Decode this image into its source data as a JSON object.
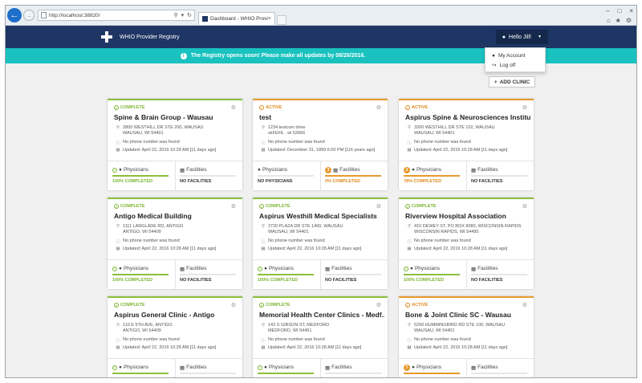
{
  "browser": {
    "url": "http://localhost:38820/",
    "tab_title": "Dashboard - WHIO Provide..."
  },
  "header": {
    "brand": "WHIO Provider Registry",
    "user_greeting": "Hello Jill!"
  },
  "banner": {
    "text": "The Registry opens soon! Please make all updates by 08/26/2016."
  },
  "user_menu": {
    "items": [
      "My Account",
      "Log off"
    ]
  },
  "toolbar": {
    "add_clinic": "ADD CLINIC"
  },
  "labels": {
    "physicians": "Physicians",
    "facilities": "Facilities"
  },
  "colors": {
    "navbar": "#1f3564",
    "banner": "#19c2bf",
    "complete": "#8cbf3f",
    "active": "#e69a2e"
  },
  "cards": [
    {
      "status": "COMPLETE",
      "name": "Spine & Brain Group - Wausau",
      "address1": "2800 WESTHILL DR STE 200, WAUSAU",
      "address2": "WAUSAU, WI 54401",
      "phone": "No phone number was found",
      "updated": "Updated: April 22, 2016 10:28 AM [11 days ago]",
      "phys_badge": "",
      "phys_pct": "100% COMPLETED",
      "fac_badge": "",
      "fac_pct": "NO FACILITIES"
    },
    {
      "status": "ACTIVE",
      "name": "test",
      "address1": "1234 testcom drive",
      "address2": "skFEFE , wi 53066",
      "phone": "No phone number was found",
      "updated": "Updated: December 31, 1899 6:00 PM [116 years ago]",
      "phys_badge": "",
      "phys_pct": "NO PHYSICIANS",
      "fac_badge": "3",
      "fac_pct": "0% COMPLETED"
    },
    {
      "status": "ACTIVE",
      "name": "Aspirus Spine & Neurosciences Institute",
      "address1": "3200 WESTHILL DR STE 102, WAUSAU",
      "address2": "WAUSAU, WI 54401",
      "phone": "No phone number was found",
      "updated": "Updated: April 22, 2016 10:28 AM [11 days ago]",
      "phys_badge": "2",
      "phys_pct": "78% COMPLETED",
      "fac_badge": "",
      "fac_pct": "NO FACILITIES"
    },
    {
      "status": "COMPLETE",
      "name": "Antigo Medical Building",
      "address1": "1111 LANGLADE RD, ANTIGO",
      "address2": "ANTIGO, WI 54409",
      "phone": "No phone number was found",
      "updated": "Updated: April 22, 2016 10:28 AM [11 days ago]",
      "phys_badge": "",
      "phys_pct": "100% COMPLETED",
      "fac_badge": "",
      "fac_pct": "NO FACILITIES"
    },
    {
      "status": "COMPLETE",
      "name": "Aspirus Westhill Medical Specialists",
      "address1": "2720 PLAZA DR STE 1400, WAUSAU",
      "address2": "WAUSAU, WI 54401",
      "phone": "No phone number was found",
      "updated": "Updated: April 22, 2016 10:28 AM [11 days ago]",
      "phys_badge": "",
      "phys_pct": "100% COMPLETED",
      "fac_badge": "",
      "fac_pct": "NO FACILITIES"
    },
    {
      "status": "COMPLETE",
      "name": "Riverview Hospital Association",
      "address1": "410 DEWEY ST, PO BOX 8080, WISCONSIN RAPIDS",
      "address2": "WISCONSIN RAPIDS, WI 54495",
      "phone": "No phone number was found",
      "updated": "Updated: April 22, 2016 10:28 AM [11 days ago]",
      "phys_badge": "",
      "phys_pct": "100% COMPLETED",
      "fac_badge": "",
      "fac_pct": "NO FACILITIES"
    },
    {
      "status": "COMPLETE",
      "name": "Aspirus General Clinic - Antigo",
      "address1": "110 E 5TH AVE, ANTIGO",
      "address2": "ANTIGO, WI 54409",
      "phone": "No phone number was found",
      "updated": "Updated: April 22, 2016 10:28 AM [11 days ago]",
      "phys_badge": "",
      "phys_pct": "",
      "fac_badge": "",
      "fac_pct": ""
    },
    {
      "status": "COMPLETE",
      "name": "Memorial Health Center Clinics - Medf...",
      "address1": "143 S GIBSON ST, MEDFORD",
      "address2": "MEDFORD, WI 54451",
      "phone": "No phone number was found",
      "updated": "Updated: April 22, 2016 10:28 AM [11 days ago]",
      "phys_badge": "",
      "phys_pct": "",
      "fac_badge": "",
      "fac_pct": ""
    },
    {
      "status": "ACTIVE",
      "name": "Bone & Joint Clinic SC - Wausau",
      "address1": "5200 HUMMINGBIRD RD STE 100, WAUSAU",
      "address2": "WAUSAU, WI 54401",
      "phone": "No phone number was found",
      "updated": "Updated: April 22, 2016 10:28 AM [11 days ago]",
      "phys_badge": "7",
      "phys_pct": "",
      "fac_badge": "",
      "fac_pct": ""
    }
  ]
}
